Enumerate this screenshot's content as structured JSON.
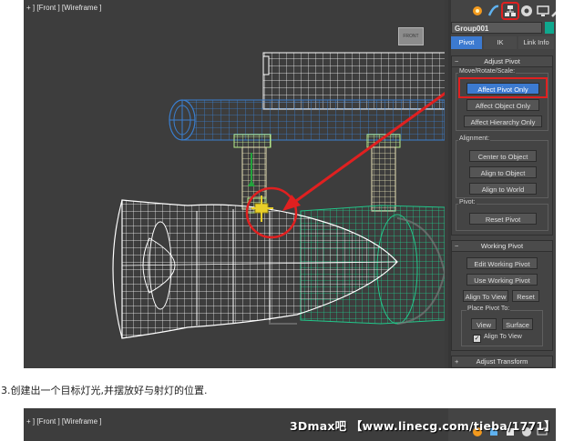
{
  "viewport": {
    "label": "+ ] [Front ] [Wireframe ]",
    "sub_label": "",
    "view_cube_label": "FRONT"
  },
  "command_panel": {
    "tabs": [
      "create-icon",
      "modify-icon",
      "hierarchy-icon",
      "motion-icon",
      "display-icon",
      "utilities-icon"
    ],
    "object_name": "Group001",
    "object_color": "#0fa88e",
    "subtabs": [
      "Pivot",
      "IK",
      "Link Info"
    ],
    "adjust_pivot": {
      "title": "Adjust Pivot",
      "move_rotate_scale_label": "Move/Rotate/Scale:",
      "affect_pivot_only": "Affect Pivot Only",
      "affect_object_only": "Affect Object Only",
      "affect_hierarchy_only": "Affect Hierarchy Only",
      "alignment_label": "Alignment:",
      "center_to_object": "Center to Object",
      "align_to_object": "Align to Object",
      "align_to_world": "Align to World",
      "pivot_label": "Pivot:",
      "reset_pivot": "Reset Pivot"
    },
    "working_pivot": {
      "title": "Working Pivot",
      "edit_working_pivot": "Edit Working Pivot",
      "use_working_pivot": "Use Working Pivot",
      "align_to_view": "Align To View",
      "reset": "Reset",
      "place_pivot_to_label": "Place Pivot To:",
      "view": "View",
      "surface": "Surface",
      "align_to_view_check": "Align To View",
      "align_to_view_checked": true
    },
    "adjust_transform": {
      "title": "Adjust Transform"
    }
  },
  "caption": "3.创建出一个目标灯光,并摆放好与射灯的位置.",
  "second_screenshot": {
    "label": "+ ] [Front ] [Wireframe ]",
    "watermark": "3Dmax吧 【www.linecg.com/tieba/1771】"
  },
  "colors": {
    "accent": "#3c7ad0",
    "highlight": "#e02020",
    "wire_white": "#ffffff",
    "wire_blue": "#3a7fd0",
    "wire_green": "#22c78a",
    "wire_lightgreen": "#b8f08a"
  }
}
